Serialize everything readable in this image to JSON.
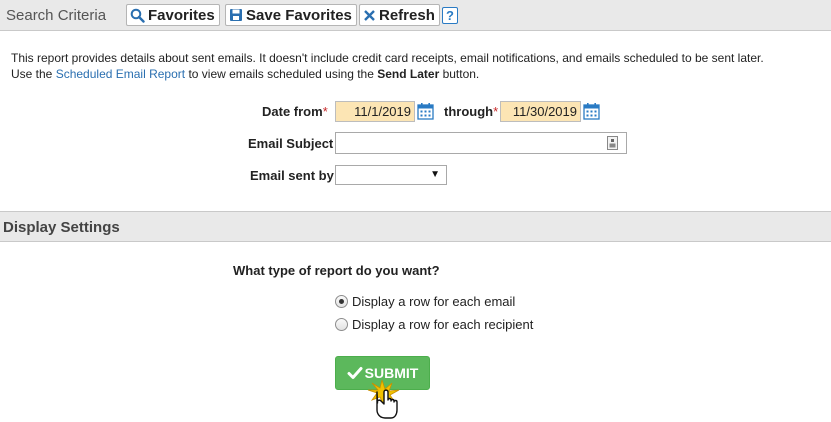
{
  "search_criteria": {
    "title": "Search Criteria",
    "favorites_label": "Favorites",
    "save_favorites_label": "Save Favorites",
    "refresh_label": "Refresh",
    "help_label": "?"
  },
  "description": {
    "line1": "This report provides details about sent emails. It doesn't include credit card receipts, email notifications, and emails scheduled to be sent later.",
    "line2_prefix": "Use the ",
    "link_text": "Scheduled Email Report",
    "line2_middle": " to view emails scheduled using the ",
    "send_later": "Send Later",
    "line2_suffix": " button."
  },
  "form": {
    "date_from_label": "Date from",
    "required_mark": "*",
    "date_from_value": "11/1/2019",
    "through_label": "through",
    "date_to_value": "11/30/2019",
    "subject_label": "Email Subject",
    "subject_value": "",
    "sent_by_label": "Email sent by",
    "sent_by_value": ""
  },
  "display_settings": {
    "title": "Display Settings",
    "question": "What type of report do you want?",
    "options": [
      {
        "label": "Display a row for each email",
        "checked": true
      },
      {
        "label": "Display a row for each recipient",
        "checked": false
      }
    ],
    "submit_label": "SUBMIT"
  },
  "colors": {
    "date_bg": "#fce5b4",
    "link": "#2a6fb0",
    "submit_green": "#5cb85c",
    "required_red": "#c62828"
  }
}
